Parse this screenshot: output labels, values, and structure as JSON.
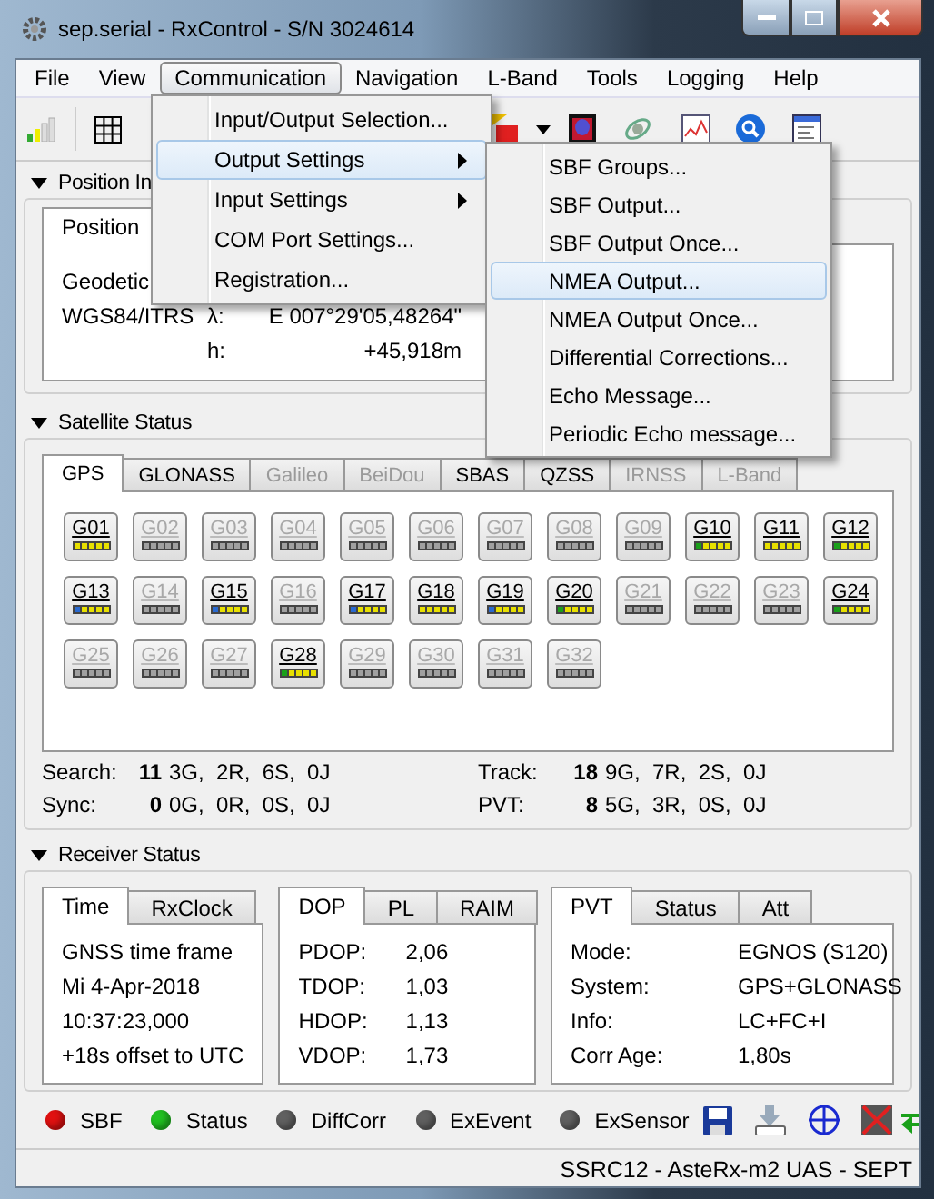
{
  "window": {
    "title": "sep.serial - RxControl - S/N 3024614"
  },
  "menubar": [
    {
      "label": "File",
      "selected": false
    },
    {
      "label": "View",
      "selected": false
    },
    {
      "label": "Communication",
      "selected": true
    },
    {
      "label": "Navigation",
      "selected": false
    },
    {
      "label": "L-Band",
      "selected": false
    },
    {
      "label": "Tools",
      "selected": false
    },
    {
      "label": "Logging",
      "selected": false
    },
    {
      "label": "Help",
      "selected": false
    }
  ],
  "menu": [
    {
      "label": "Input/Output Selection...",
      "kind": "command",
      "selected": false
    },
    {
      "label": "Output Settings",
      "kind": "submenu",
      "selected": true
    },
    {
      "label": "Input Settings",
      "kind": "submenu",
      "selected": false
    },
    {
      "label": "COM Port Settings...",
      "kind": "command",
      "selected": false
    },
    {
      "label": "Registration...",
      "kind": "command",
      "selected": false
    }
  ],
  "submenu": [
    {
      "label": "SBF Groups...",
      "selected": false
    },
    {
      "label": "SBF Output...",
      "selected": false
    },
    {
      "label": "SBF Output Once...",
      "selected": false
    },
    {
      "label": "NMEA Output...",
      "selected": true
    },
    {
      "label": "NMEA Output Once...",
      "selected": false
    },
    {
      "label": "Differential Corrections...",
      "selected": false
    },
    {
      "label": "Echo Message...",
      "selected": false
    },
    {
      "label": "Periodic Echo message...",
      "selected": false
    }
  ],
  "position": {
    "heading": "Position In",
    "tab": "Position",
    "frame": "Geodetic",
    "datum": "WGS84/ITRS",
    "rows": [
      {
        "label": "λ:",
        "value": "E 007°29'05,48264\""
      },
      {
        "label": "h:",
        "value": "+45,918m"
      }
    ]
  },
  "satellite_status": {
    "heading": "Satellite Status",
    "tabs": [
      {
        "label": "GPS",
        "selected": true,
        "disabled": false
      },
      {
        "label": "GLONASS",
        "selected": false,
        "disabled": false
      },
      {
        "label": "Galileo",
        "selected": false,
        "disabled": true
      },
      {
        "label": "BeiDou",
        "selected": false,
        "disabled": true
      },
      {
        "label": "SBAS",
        "selected": false,
        "disabled": false
      },
      {
        "label": "QZSS",
        "selected": false,
        "disabled": false
      },
      {
        "label": "IRNSS",
        "selected": false,
        "disabled": true
      },
      {
        "label": "L-Band",
        "selected": false,
        "disabled": true
      }
    ],
    "satellites": [
      {
        "label": "G01",
        "tracked": true,
        "color": "#e8e000"
      },
      {
        "label": "G02",
        "tracked": false,
        "color": "#a0a0a0"
      },
      {
        "label": "G03",
        "tracked": false,
        "color": "#a0a0a0"
      },
      {
        "label": "G04",
        "tracked": false,
        "color": "#a0a0a0"
      },
      {
        "label": "G05",
        "tracked": false,
        "color": "#a0a0a0"
      },
      {
        "label": "G06",
        "tracked": false,
        "color": "#a0a0a0"
      },
      {
        "label": "G07",
        "tracked": false,
        "color": "#a0a0a0"
      },
      {
        "label": "G08",
        "tracked": false,
        "color": "#a0a0a0"
      },
      {
        "label": "G09",
        "tracked": false,
        "color": "#a0a0a0"
      },
      {
        "label": "G10",
        "tracked": true,
        "color": "#1aa01a"
      },
      {
        "label": "G11",
        "tracked": true,
        "color": "#e8e000"
      },
      {
        "label": "G12",
        "tracked": true,
        "color": "#1aa01a"
      },
      {
        "label": "G13",
        "tracked": true,
        "color": "#2a6ad0"
      },
      {
        "label": "G14",
        "tracked": false,
        "color": "#a0a0a0"
      },
      {
        "label": "G15",
        "tracked": true,
        "color": "#2a6ad0"
      },
      {
        "label": "G16",
        "tracked": false,
        "color": "#a0a0a0"
      },
      {
        "label": "G17",
        "tracked": true,
        "color": "#2a6ad0"
      },
      {
        "label": "G18",
        "tracked": true,
        "color": "#e8e000"
      },
      {
        "label": "G19",
        "tracked": true,
        "color": "#2a6ad0"
      },
      {
        "label": "G20",
        "tracked": true,
        "color": "#1aa01a"
      },
      {
        "label": "G21",
        "tracked": false,
        "color": "#a0a0a0"
      },
      {
        "label": "G22",
        "tracked": false,
        "color": "#a0a0a0"
      },
      {
        "label": "G23",
        "tracked": false,
        "color": "#a0a0a0"
      },
      {
        "label": "G24",
        "tracked": true,
        "color": "#1aa01a"
      },
      {
        "label": "G25",
        "tracked": false,
        "color": "#a0a0a0"
      },
      {
        "label": "G26",
        "tracked": false,
        "color": "#a0a0a0"
      },
      {
        "label": "G27",
        "tracked": false,
        "color": "#a0a0a0"
      },
      {
        "label": "G28",
        "tracked": true,
        "color": "#1aa01a"
      },
      {
        "label": "G29",
        "tracked": false,
        "color": "#a0a0a0"
      },
      {
        "label": "G30",
        "tracked": false,
        "color": "#a0a0a0"
      },
      {
        "label": "G31",
        "tracked": false,
        "color": "#a0a0a0"
      },
      {
        "label": "G32",
        "tracked": false,
        "color": "#a0a0a0"
      }
    ],
    "counts": [
      {
        "label": "Search:",
        "total": "11",
        "detail": "3G,  2R,  6S,  0J"
      },
      {
        "label": "Track:",
        "total": "18",
        "detail": "9G,  7R,  2S,  0J"
      },
      {
        "label": "Sync:",
        "total": "0",
        "detail": "0G,  0R,  0S,  0J"
      },
      {
        "label": "PVT:",
        "total": "8",
        "detail": "5G,  3R,  0S,  0J"
      }
    ]
  },
  "receiver_status": {
    "heading": "Receiver Status",
    "panels": [
      {
        "tabs": [
          {
            "label": "Time",
            "selected": true
          },
          {
            "label": "RxClock",
            "selected": false
          }
        ],
        "kind": "lines",
        "lines": [
          "GNSS time frame",
          "Mi 4-Apr-2018",
          "10:37:23,000",
          "+18s offset to UTC"
        ]
      },
      {
        "tabs": [
          {
            "label": "DOP",
            "selected": true
          },
          {
            "label": "PL",
            "selected": false
          },
          {
            "label": "RAIM",
            "selected": false
          }
        ],
        "kind": "pairs",
        "rows": [
          {
            "label": "PDOP:",
            "value": "2,06"
          },
          {
            "label": "TDOP:",
            "value": "1,03"
          },
          {
            "label": "HDOP:",
            "value": "1,13"
          },
          {
            "label": "VDOP:",
            "value": "1,73"
          }
        ]
      },
      {
        "tabs": [
          {
            "label": "PVT",
            "selected": true
          },
          {
            "label": "Status",
            "selected": false
          },
          {
            "label": "Att",
            "selected": false
          }
        ],
        "kind": "pairs",
        "rows": [
          {
            "label": "Mode:",
            "value": "EGNOS (S120)"
          },
          {
            "label": "System:",
            "value": "GPS+GLONASS"
          },
          {
            "label": "Info:",
            "value": "LC+FC+I"
          },
          {
            "label": "Corr Age:",
            "value": "1,80s"
          }
        ]
      }
    ]
  },
  "indicators": [
    {
      "label": "SBF",
      "color": "#e01010"
    },
    {
      "label": "Status",
      "color": "#20c020"
    },
    {
      "label": "DiffCorr",
      "color": "#606060"
    },
    {
      "label": "ExEvent",
      "color": "#606060"
    },
    {
      "label": "ExSensor",
      "color": "#606060"
    }
  ],
  "status_bar": "SSRC12 - AsteRx-m2 UAS - SEPT"
}
